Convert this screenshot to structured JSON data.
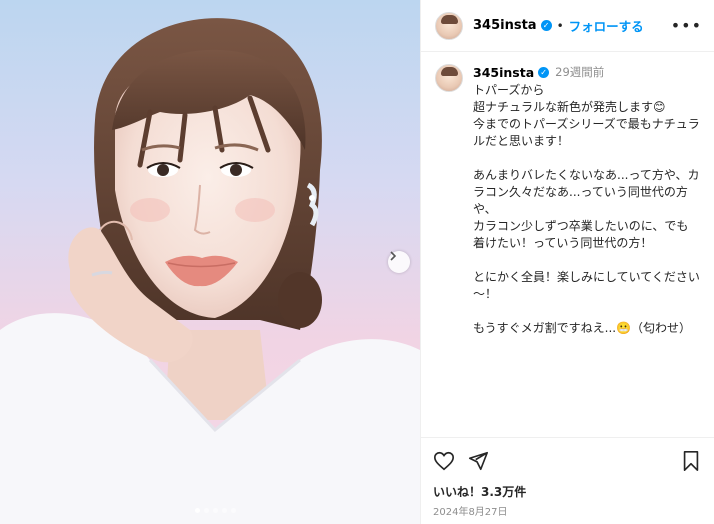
{
  "account": {
    "username": "345insta",
    "follow_label": "フォローする",
    "separator": "•"
  },
  "caption": {
    "time_ago": "29週間前",
    "text": "トパーズから\n超ナチュラルな新色が発売します😊\n今までのトパーズシリーズで最もナチュラルだと思います！\n\nあんまりバレたくないなあ...って方や、カラコン久々だなあ...っていう同世代の方や、\nカラコン少しずつ卒業したいのに、でも着けたい！っていう同世代の方！\n\nとにかく全員！楽しみにしていてください～！\n\nもうすぐメガ割ですねえ...😬（匂わせ）"
  },
  "engagement": {
    "likes": "いいね！3.3万件",
    "date": "2024年8月27日"
  },
  "icons": {
    "verified": "verified-badge-icon",
    "more": "more-options-icon",
    "like": "heart-icon",
    "share": "send-icon",
    "save": "bookmark-icon",
    "next": "chevron-right-icon"
  },
  "colors": {
    "accent": "#0095f6",
    "text": "#262626",
    "muted": "#8e8e8e"
  },
  "carousel": {
    "slide_count": 5,
    "active_index": 0
  }
}
